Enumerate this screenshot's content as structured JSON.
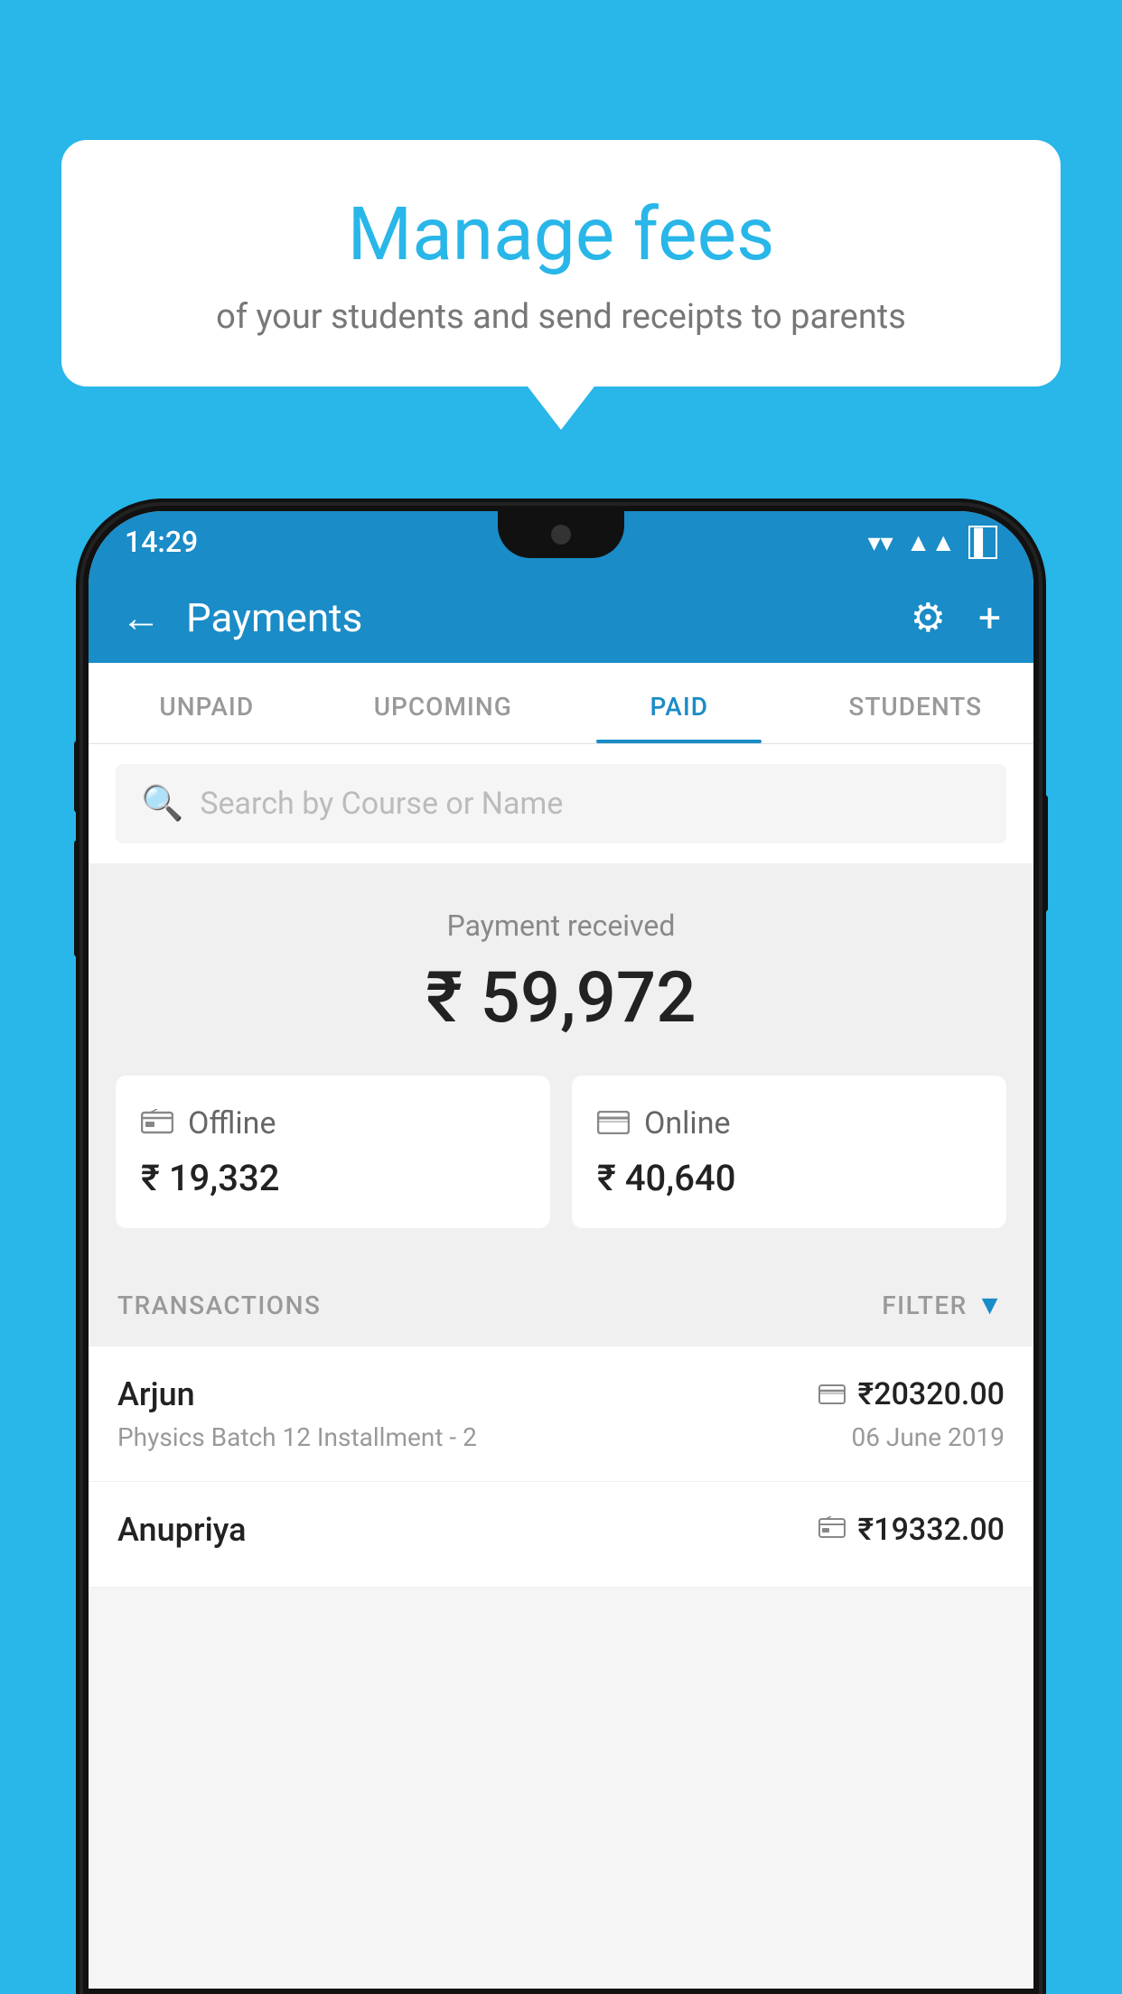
{
  "background_color": "#29b6e8",
  "speech_bubble": {
    "title": "Manage fees",
    "subtitle": "of your students and send receipts to parents"
  },
  "status_bar": {
    "time": "14:29",
    "wifi": "▼",
    "signal": "▲",
    "battery": "▐"
  },
  "header": {
    "title": "Payments",
    "back_icon": "←",
    "settings_icon": "⚙",
    "add_icon": "+"
  },
  "tabs": [
    {
      "label": "UNPAID",
      "active": false
    },
    {
      "label": "UPCOMING",
      "active": false
    },
    {
      "label": "PAID",
      "active": true
    },
    {
      "label": "STUDENTS",
      "active": false
    }
  ],
  "search": {
    "placeholder": "Search by Course or Name"
  },
  "payment_summary": {
    "label": "Payment received",
    "total": "₹ 59,972",
    "offline_label": "Offline",
    "offline_amount": "₹ 19,332",
    "online_label": "Online",
    "online_amount": "₹ 40,640"
  },
  "transactions_section": {
    "label": "TRANSACTIONS",
    "filter_label": "FILTER"
  },
  "transactions": [
    {
      "name": "Arjun",
      "course": "Physics Batch 12 Installment - 2",
      "amount": "₹20320.00",
      "date": "06 June 2019",
      "type": "online"
    },
    {
      "name": "Anupriya",
      "course": "",
      "amount": "₹19332.00",
      "date": "",
      "type": "offline"
    }
  ]
}
